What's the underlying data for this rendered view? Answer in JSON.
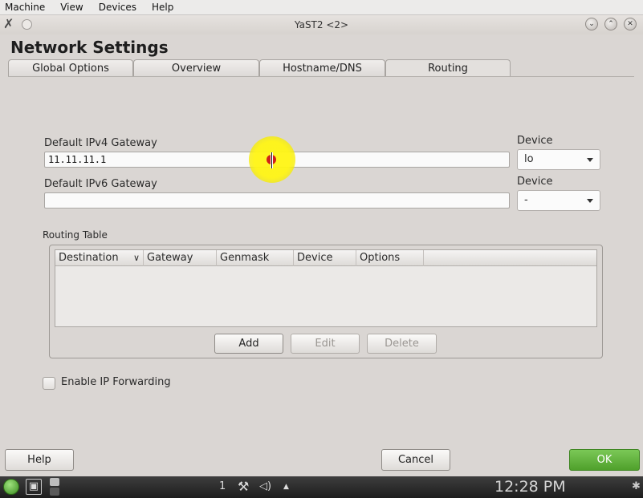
{
  "vm_menu": [
    "Machine",
    "View",
    "Devices",
    "Help"
  ],
  "window": {
    "title": "YaST2 <2>",
    "left_icon": "x-close-icon",
    "right_buttons": [
      {
        "name": "minimize-button",
        "glyph": "⌄"
      },
      {
        "name": "maximize-button",
        "glyph": "⌃"
      },
      {
        "name": "close-button",
        "glyph": "✕"
      }
    ]
  },
  "page": {
    "title": "Network Settings"
  },
  "tabs": [
    {
      "label": "Global Options",
      "active": false
    },
    {
      "label": "Overview",
      "active": false
    },
    {
      "label": "Hostname/DNS",
      "active": false
    },
    {
      "label": "Routing",
      "active": true
    }
  ],
  "ipv4": {
    "label": "Default IPv4 Gateway",
    "value": "11.11.11.1",
    "device_label": "Device",
    "device_value": "lo"
  },
  "ipv6": {
    "label": "Default IPv6 Gateway",
    "value": "",
    "device_label": "Device",
    "device_value": "-"
  },
  "routing_table": {
    "label": "Routing Table",
    "columns": [
      "Destination",
      "Gateway",
      "Genmask",
      "Device",
      "Options"
    ],
    "sort_indicator": "∨",
    "rows": []
  },
  "buttons": {
    "add": "Add",
    "edit": "Edit",
    "delete": "Delete"
  },
  "ip_forwarding": {
    "label": "Enable IP Forwarding",
    "checked": false
  },
  "footer": {
    "help": "Help",
    "cancel": "Cancel",
    "ok": "OK"
  },
  "taskbar": {
    "desktop_number": "1",
    "up_arrow": "▲",
    "clock": "12:28 PM"
  },
  "colors": {
    "ok_green": "#5fb23b",
    "cursor_highlight": "#fff21a"
  }
}
